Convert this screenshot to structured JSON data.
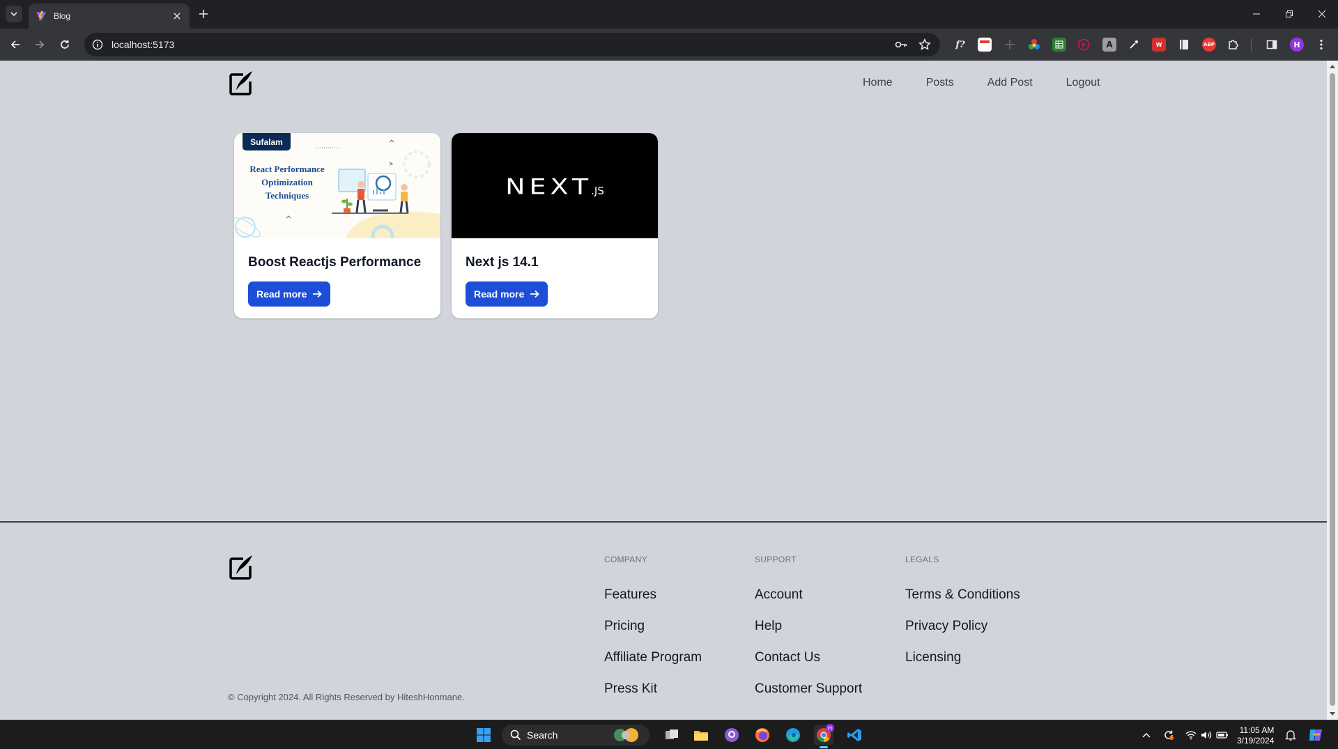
{
  "browser": {
    "tab": {
      "title": "Blog"
    },
    "url": "localhost:5173",
    "profile_initial": "H"
  },
  "site": {
    "nav": [
      "Home",
      "Posts",
      "Add Post",
      "Logout"
    ],
    "posts": [
      {
        "title": "Boost Reactjs Performance",
        "button": "Read more",
        "image": {
          "brand": "Sufalam",
          "headline_lines": [
            "React Performance",
            "Optimization",
            "Techniques"
          ]
        }
      },
      {
        "title": "Next js 14.1",
        "button": "Read more",
        "image": {
          "wordmark": "NEXT",
          "suffix": ".JS"
        }
      }
    ],
    "footer": {
      "columns": [
        {
          "heading": "COMPANY",
          "links": [
            "Features",
            "Pricing",
            "Affiliate Program",
            "Press Kit"
          ]
        },
        {
          "heading": "SUPPORT",
          "links": [
            "Account",
            "Help",
            "Contact Us",
            "Customer Support"
          ]
        },
        {
          "heading": "LEGALS",
          "links": [
            "Terms & Conditions",
            "Privacy Policy",
            "Licensing"
          ]
        }
      ],
      "copyright": "© Copyright 2024. All Rights Reserved by HiteshHonmane."
    }
  },
  "taskbar": {
    "search_placeholder": "Search",
    "time": "11:05 AM",
    "date": "3/19/2024"
  },
  "colors": {
    "page_bg": "#d1d5db",
    "button_bg": "#1d4ed8",
    "chrome_dark": "#202124",
    "chrome_toolbar": "#35363a"
  }
}
